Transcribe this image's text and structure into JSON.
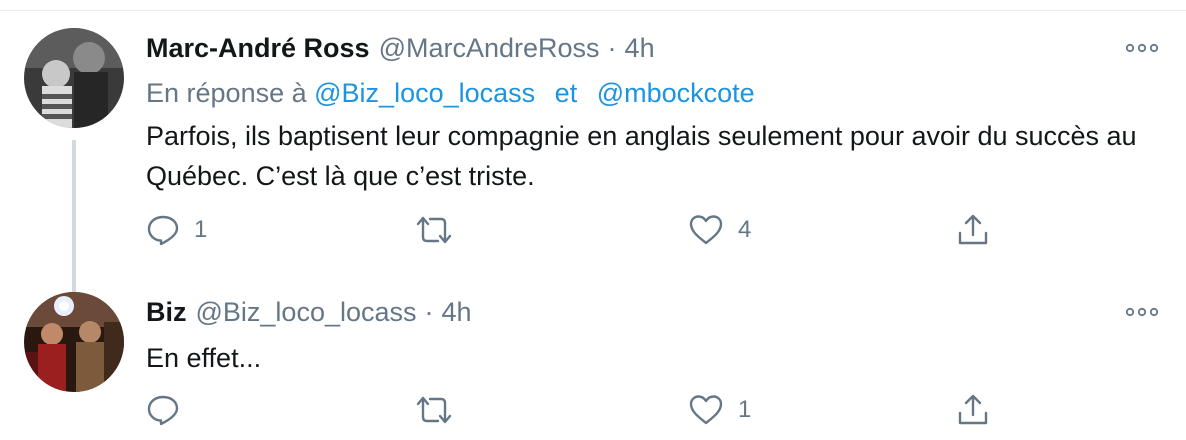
{
  "tweets": [
    {
      "display_name": "Marc-André Ross",
      "handle": "@MarcAndreRoss",
      "separator": "·",
      "time": "4h",
      "reply_prefix": "En réponse à",
      "reply_mentions": [
        "@Biz_loco_locass",
        "@mbockcote"
      ],
      "reply_joiner": "et",
      "text": "Parfois, ils baptisent leur compagnie en anglais seulement pour avoir du succès au Québec. C’est là que c’est triste.",
      "reply_count": "1",
      "retweet_count": "",
      "like_count": "4"
    },
    {
      "display_name": "Biz",
      "handle": "@Biz_loco_locass",
      "separator": "·",
      "time": "4h",
      "text": "En effet...",
      "reply_count": "",
      "retweet_count": "",
      "like_count": "1"
    }
  ],
  "icons": {
    "reply": "reply-icon",
    "retweet": "retweet-icon",
    "like": "heart-icon",
    "share": "share-icon",
    "more": "more-icon"
  },
  "colors": {
    "link": "#1b95e0",
    "secondary_text": "#657786",
    "primary_text": "#14171a",
    "thread_line": "#cfd9de"
  }
}
